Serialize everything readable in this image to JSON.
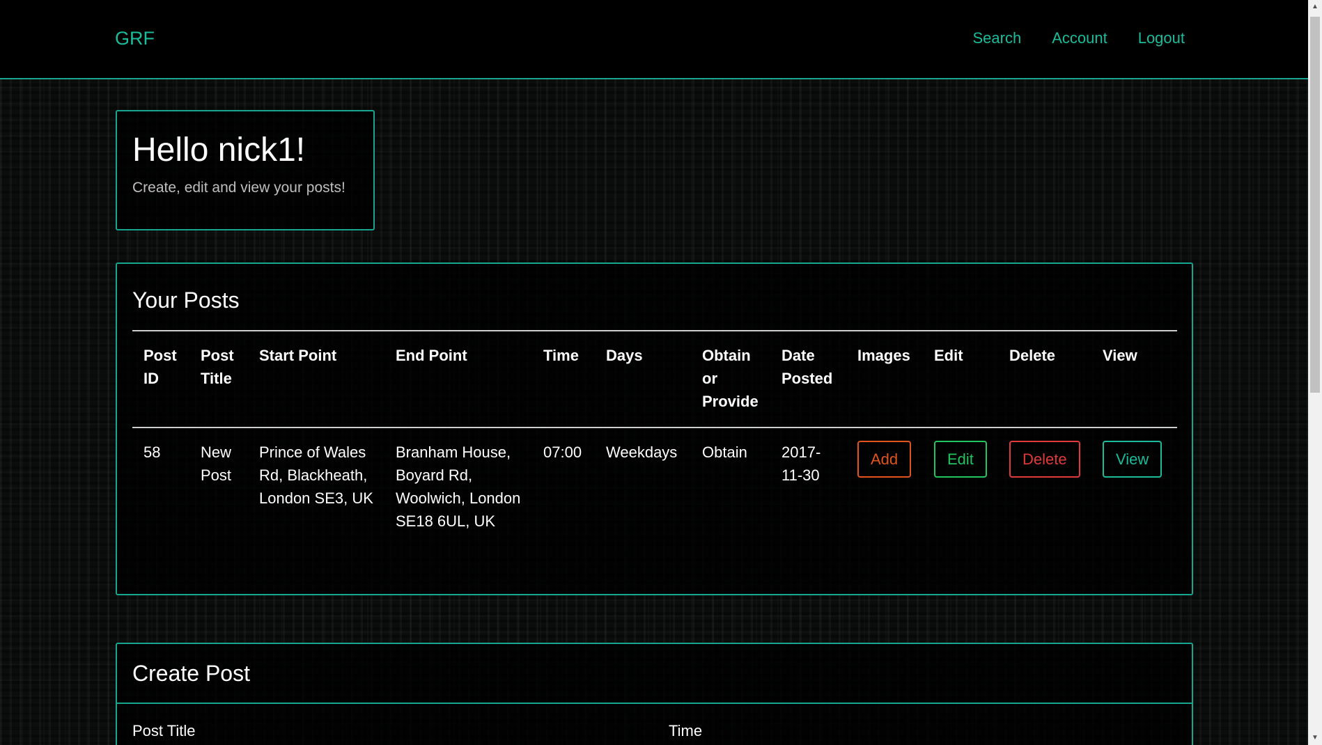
{
  "navbar": {
    "brand": "GRF",
    "links": [
      "Search",
      "Account",
      "Logout"
    ]
  },
  "hello": {
    "title": "Hello nick1!",
    "subtitle": "Create, edit and view your posts!"
  },
  "posts": {
    "heading": "Your Posts",
    "columns": [
      "Post ID",
      "Post Title",
      "Start Point",
      "End Point",
      "Time",
      "Days",
      "Obtain or Provide",
      "Date Posted",
      "Images",
      "Edit",
      "Delete",
      "View"
    ],
    "rows": [
      {
        "id": "58",
        "title": "New Post",
        "start": "Prince of Wales Rd, Blackheath, London SE3, UK",
        "end": "Branham House, Boyard Rd, Woolwich, London SE18 6UL, UK",
        "time": "07:00",
        "days": "Weekdays",
        "obtain_provide": "Obtain",
        "date_posted": "2017-11-30",
        "images_button": "Add",
        "edit_button": "Edit",
        "delete_button": "Delete",
        "view_button": "View"
      }
    ]
  },
  "create": {
    "heading": "Create Post",
    "labels": {
      "post_title": "Post Title",
      "time": "Time"
    }
  },
  "colors": {
    "accent": "#1abc9c",
    "add": "#e2541c",
    "edit": "#22c55e",
    "delete": "#e03a3a"
  }
}
